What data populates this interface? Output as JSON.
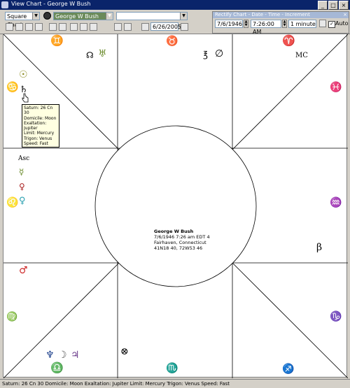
{
  "window": {
    "title": "View Chart - George W Bush"
  },
  "toolbar": {
    "chart_type": "Square Chart",
    "person": "George W Bush",
    "extra_combo": "",
    "date": "6/26/2005"
  },
  "rectify": {
    "title": "Rectify Chart - Date - Time - Increment",
    "date": "7/6/1946",
    "time": "7:26:00 AM",
    "increment": "1 minute",
    "auto_label": "Auto"
  },
  "chart": {
    "name": "George W Bush",
    "line1": "7/6/1946  7:26 am  EDT 4",
    "line2": "Fairhaven, Connecticut",
    "line3": "41N18 40,  72W53 46",
    "asc_label": "Asc",
    "mc_label": "MC",
    "beta_label": "β"
  },
  "tooltip": {
    "lines": [
      "Saturn: 26 Cn 30",
      "Domicile: Moon",
      "Exaltation: Jupiter",
      "Limit: Mercury",
      "Trigon: Venus",
      "Speed: Fast"
    ]
  },
  "status": {
    "text": "Saturn: 26 Cn 30 Domicile: Moon Exaltation: Jupiter Limit: Mercury Trigon: Venus Speed: Fast"
  },
  "colors": {
    "titlebar": "#0a246a",
    "chart_bg": "#ffffff",
    "tooltip_bg": "#ffffe1"
  }
}
